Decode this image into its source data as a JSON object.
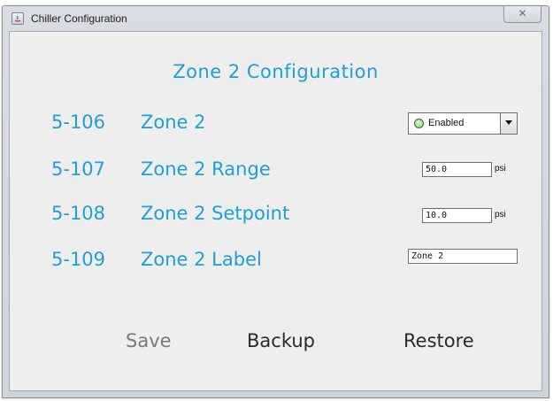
{
  "window": {
    "title": "Chiller Configuration",
    "close_glyph": "✕"
  },
  "heading": "Zone 2 Configuration",
  "rows": [
    {
      "code": "5-106",
      "label": "Zone 2"
    },
    {
      "code": "5-107",
      "label": "Zone 2 Range"
    },
    {
      "code": "5-108",
      "label": "Zone 2 Setpoint"
    },
    {
      "code": "5-109",
      "label": "Zone 2 Label"
    }
  ],
  "controls": {
    "zone_state": {
      "selected": "Enabled",
      "indicator_color": "#8fcf74"
    },
    "range": {
      "value": "50.0",
      "unit": "psi"
    },
    "setpoint": {
      "value": "10.0",
      "unit": "psi"
    },
    "label": {
      "value": "Zone 2"
    }
  },
  "buttons": {
    "save": "Save",
    "backup": "Backup",
    "restore": "Restore"
  },
  "colors": {
    "accent": "#1f9fd9",
    "disabled_text": "#7a7a7a",
    "button_text": "#2a2a2a"
  }
}
